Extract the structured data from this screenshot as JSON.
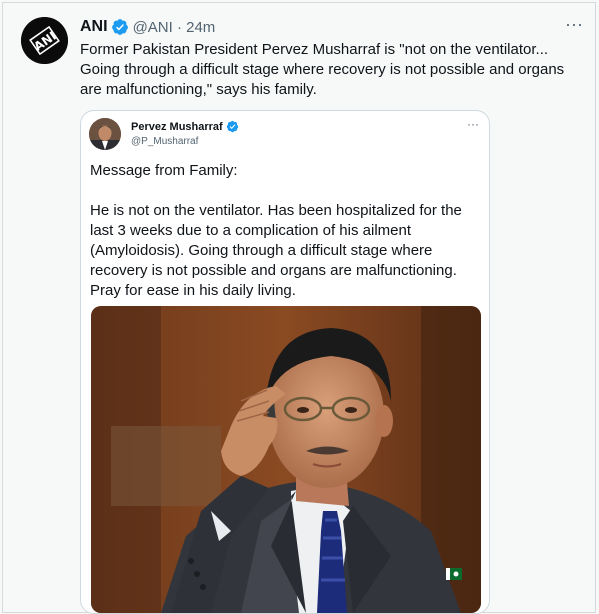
{
  "tweet": {
    "author_name": "ANI",
    "handle_time": "@ANI · 24m",
    "text": "Former Pakistan President Pervez Musharraf is \"not on the ventilator... Going through a difficult stage where recovery is not possible and organs are malfunctioning,\" says his family.",
    "more_label": "···",
    "avatar_icon": "ani-logo-icon"
  },
  "quote": {
    "author_name": "Pervez Musharraf",
    "handle": "@P_Musharraf",
    "more_label": "···",
    "text": "Message from Family:\n\nHe is not on the ventilator. Has been hospitalized for the last 3 weeks due to a complication of his ailment (Amyloidosis).  Going through a difficult stage where recovery is not possible and organs are malfunctioning. Pray for ease in his daily living."
  },
  "colors": {
    "verified": "#1d9bf0",
    "background": "#f7f9f9",
    "secondary_text": "#536471"
  }
}
